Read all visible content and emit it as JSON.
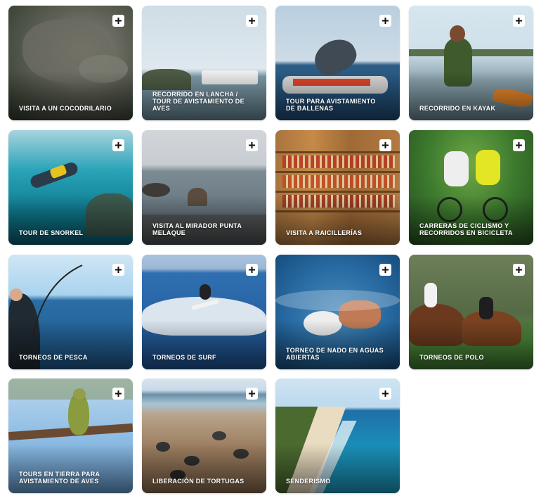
{
  "cards": [
    {
      "label": "VISITA A UN COCODRILARIO",
      "icon": "plus-icon"
    },
    {
      "label": "RECORRIDO EN LANCHA / TOUR DE AVISTAMIENTO DE AVES",
      "icon": "plus-icon"
    },
    {
      "label": "TOUR PARA AVISTAMIENTO DE BALLENAS",
      "icon": "plus-icon"
    },
    {
      "label": "RECORRIDO EN KAYAK",
      "icon": "plus-icon"
    },
    {
      "label": "TOUR DE SNORKEL",
      "icon": "plus-icon"
    },
    {
      "label": "VISITA AL MIRADOR PUNTA MELAQUE",
      "icon": "plus-icon"
    },
    {
      "label": "VISITA A RAICILLERÍAS",
      "icon": "plus-icon"
    },
    {
      "label": "CARRERAS DE CICLISMO Y RECORRIDOS EN BICICLETA",
      "icon": "plus-icon"
    },
    {
      "label": "TORNEOS DE PESCA",
      "icon": "plus-icon"
    },
    {
      "label": "TORNEOS DE SURF",
      "icon": "plus-icon"
    },
    {
      "label": "TORNEO DE NADO EN AGUAS ABIERTAS",
      "icon": "plus-icon"
    },
    {
      "label": "TORNEOS DE POLO",
      "icon": "plus-icon"
    },
    {
      "label": "TOURS EN TIERRA PARA AVISTAMIENTO DE AVES",
      "icon": "plus-icon"
    },
    {
      "label": "LIBERACIÓN DE TORTUGAS",
      "icon": "plus-icon"
    },
    {
      "label": "SENDERISMO",
      "icon": "plus-icon"
    }
  ]
}
